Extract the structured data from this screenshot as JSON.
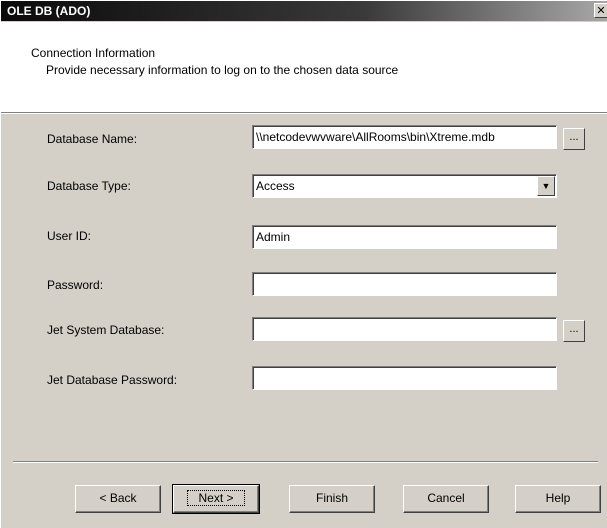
{
  "window": {
    "title": "OLE DB (ADO)",
    "close_glyph": "✕"
  },
  "header": {
    "title": "Connection Information",
    "subtitle": "Provide necessary information to log on to the chosen data source"
  },
  "form": {
    "database_name": {
      "label": "Database Name:",
      "value": "\\\\netcodevwvware\\AllRooms\\bin\\Xtreme.mdb",
      "browse": "..."
    },
    "database_type": {
      "label": "Database Type:",
      "value": "Access",
      "arrow_icon": "chevron-down-icon"
    },
    "user_id": {
      "label": "User ID:",
      "value": "Admin"
    },
    "password": {
      "label": "Password:",
      "value": ""
    },
    "jet_system_database": {
      "label": "Jet System Database:",
      "value": "",
      "browse": "..."
    },
    "jet_database_password": {
      "label": "Jet Database Password:",
      "value": ""
    }
  },
  "buttons": {
    "back": "< Back",
    "next": "Next >",
    "finish": "Finish",
    "cancel": "Cancel",
    "help": "Help"
  },
  "colors": {
    "face": "#d4d0c8",
    "title_bar": "#0a0a0a"
  }
}
